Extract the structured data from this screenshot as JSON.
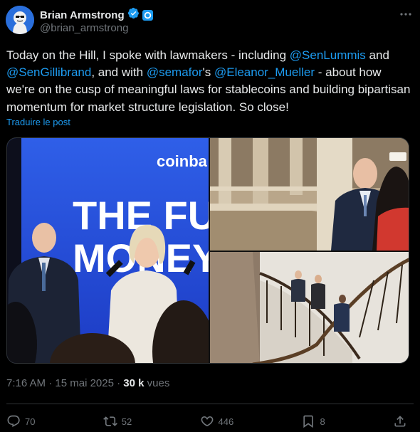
{
  "author": {
    "display_name": "Brian Armstrong",
    "handle": "@brian_armstrong",
    "verified_icon": "verified-badge-icon",
    "org_badge_icon": "coinbase-badge-icon"
  },
  "tweet": {
    "text_parts": [
      {
        "t": "Today on the Hill, I spoke with lawmakers - including ",
        "m": false
      },
      {
        "t": "@SenLummis",
        "m": true
      },
      {
        "t": " and ",
        "m": false
      },
      {
        "t": "@SenGillibrand",
        "m": true
      },
      {
        "t": ", and with ",
        "m": false
      },
      {
        "t": "@semafor",
        "m": true
      },
      {
        "t": "'s ",
        "m": false
      },
      {
        "t": "@Eleanor_Mueller",
        "m": true
      },
      {
        "t": " - about how we're on the cusp of meaningful laws for stablecoins and building bipartisan momentum for market structure legislation. So close!",
        "m": false
      }
    ],
    "translate_label": "Traduire le post"
  },
  "media": {
    "stage_brand": "coinba",
    "stage_line1": "THE FUTU",
    "stage_line2": "MONEY IS"
  },
  "meta": {
    "time": "7:16 AM",
    "separator": " · ",
    "date": "15 mai 2025",
    "views_count": "30 k",
    "views_label": "vues"
  },
  "actions": {
    "replies": "70",
    "reposts": "52",
    "likes": "446",
    "bookmarks": "8"
  },
  "colors": {
    "accent": "#1d9bf0",
    "background": "#000000",
    "muted": "#71767b"
  }
}
